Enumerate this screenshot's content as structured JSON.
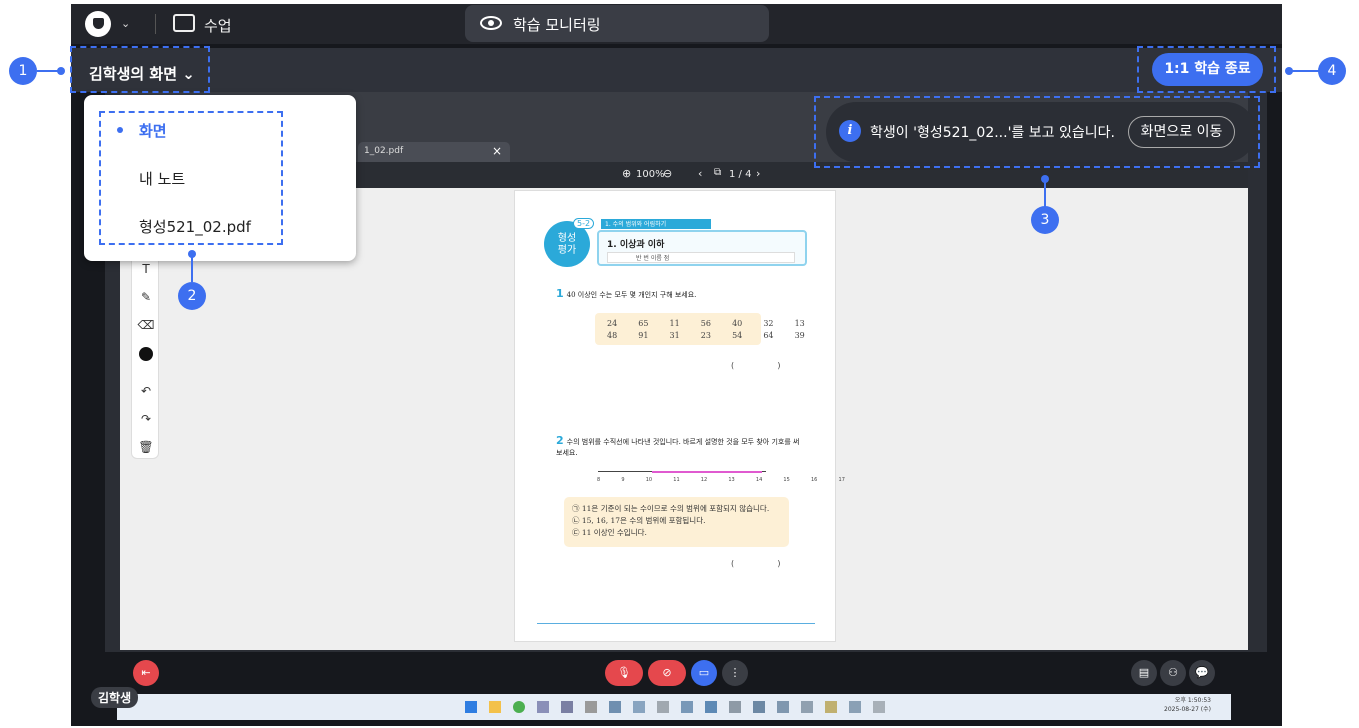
{
  "topbar": {
    "class_label": "수업",
    "monitor_label": "학습 모니터링"
  },
  "student_bar": {
    "screen_select_label": "김학생의 화면",
    "end_button_label": "1:1 학습 종료"
  },
  "browser": {
    "tab_title": "1_02.pdf",
    "tab_close": "×"
  },
  "viewer": {
    "zoom": "100%",
    "page_indicator": "1 / 4"
  },
  "document": {
    "badge_title": "형성\n평가",
    "badge_number": "5-2",
    "unit_ribbon": "1. 수의 범위와 어림하기",
    "lesson_title": "1. 이상과 이하",
    "lesson_fields": "반    번  이름                              점",
    "q1_number": "1",
    "q1_text": "40 이상인 수는 모두 몇 개인지 구해 보세요.",
    "numbers_row1": "24  65  11  56  40  32  13",
    "numbers_row2": "48  91  31  23  54  64  39",
    "answer_paren": "(                 )",
    "q2_number": "2",
    "q2_text": "수의 범위를 수직선에 나타낸 것입니다. 바르게 설명한 것을 모두 찾아 기호를 써 보세요.",
    "numline_labels": "8  9  10  11  12  13  14  15  16  17",
    "option1": "㉠ 11은 기준이 되는 수이므로 수의 범위에 포함되지 않습니다.",
    "option2": "㉡ 15, 16, 17은 수의 범위에 포함됩니다.",
    "option3": "㉢ 11 이상인 수입니다."
  },
  "dropdown": {
    "items": [
      {
        "label": "화면",
        "active": true
      },
      {
        "label": "내 노트",
        "active": false
      },
      {
        "label": "형성521_02.pdf",
        "active": false
      }
    ]
  },
  "notice": {
    "text": "학생이 '형성521_02...'를 보고 있습니다.",
    "button_label": "화면으로 이동"
  },
  "control_bar": {
    "student_name": "김학생"
  },
  "taskbar": {
    "clock_time": "오후 1:50:53",
    "clock_date": "2025-08-27 (수)"
  },
  "callouts": [
    "1",
    "2",
    "3",
    "4"
  ],
  "colors": {
    "accent": "#3d6ff0",
    "danger": "#e5484d",
    "document_blue": "#2ba9d9"
  }
}
